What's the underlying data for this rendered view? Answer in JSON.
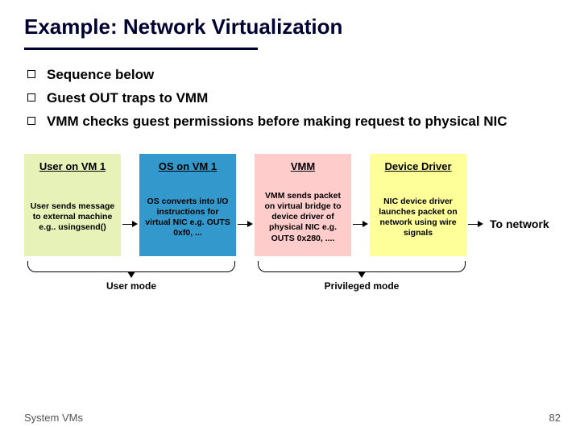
{
  "title": "Example: Network Virtualization",
  "bullets": [
    "Sequence below",
    "Guest OUT traps to VMM",
    "VMM checks guest permissions before making request to physical NIC"
  ],
  "cols": [
    {
      "header": "User on VM 1",
      "body": "User sends message to external machine e.g.. usingsend()"
    },
    {
      "header": "OS on VM 1",
      "body": "OS converts into I/O instructions for virtual NIC e.g. OUTS  0xf0, ..."
    },
    {
      "header": "VMM",
      "body": "VMM sends packet on virtual bridge to device driver of physical NIC e.g. OUTS  0x280, ...."
    },
    {
      "header": "Device Driver",
      "body": "NIC device driver launches packet on network using wire signals"
    }
  ],
  "to_network": "To network",
  "mode_labels": {
    "user": "User mode",
    "priv": "Privileged mode"
  },
  "footer": "System VMs",
  "page": "82"
}
